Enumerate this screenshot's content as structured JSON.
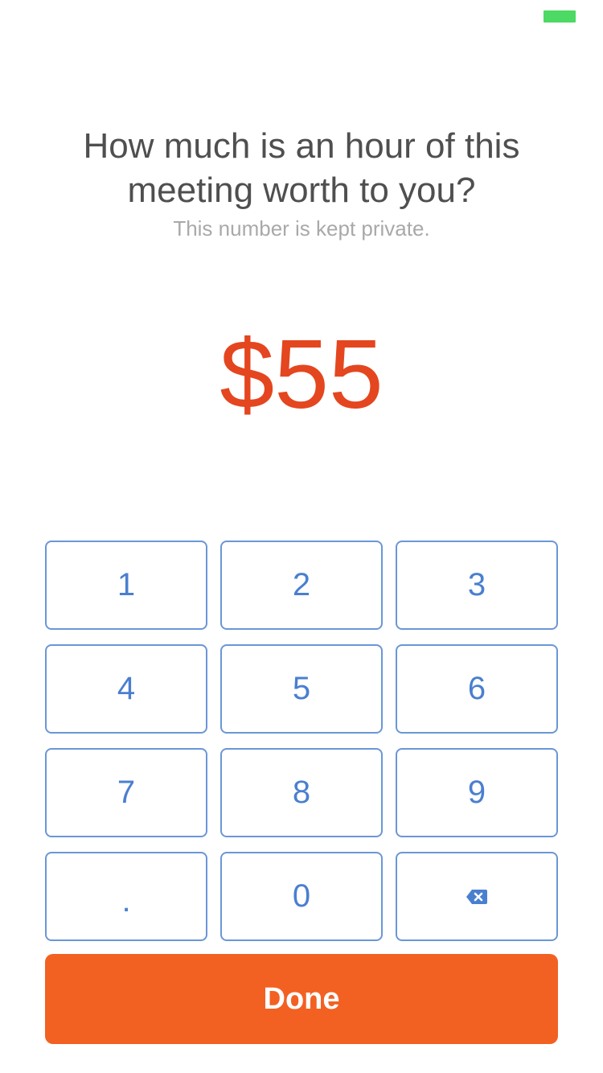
{
  "status_bar": {
    "battery_color": "#4cd964"
  },
  "prompt": {
    "title": "How much is an hour of this meeting worth to you?",
    "subtitle": "This number is kept private."
  },
  "amount": {
    "display": "$55",
    "color": "#e4461f"
  },
  "keypad": {
    "keys": [
      "1",
      "2",
      "3",
      "4",
      "5",
      "6",
      "7",
      "8",
      "9",
      ".",
      "0"
    ],
    "backspace_icon": "backspace-icon",
    "accent_color": "#4a7fd0"
  },
  "done_button": {
    "label": "Done",
    "color": "#f26122"
  }
}
